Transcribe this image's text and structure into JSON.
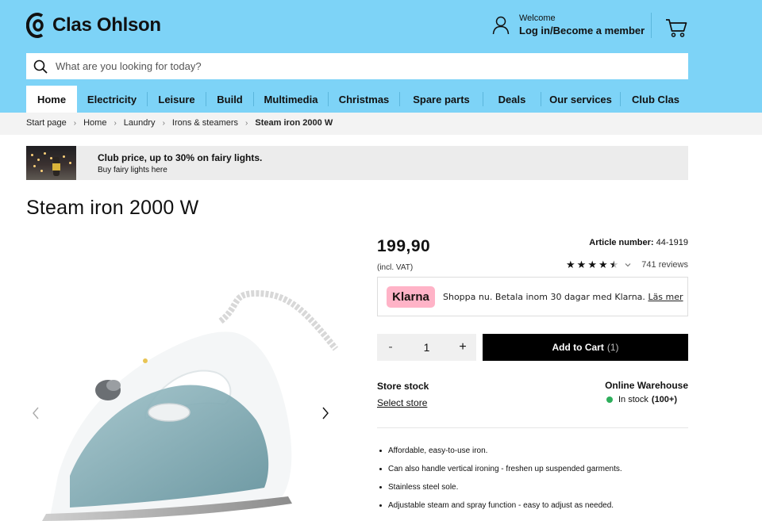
{
  "brand": {
    "name": "Clas Ohlson"
  },
  "account": {
    "welcome": "Welcome",
    "login": "Log in/Become a member"
  },
  "search": {
    "placeholder": "What are you looking for today?"
  },
  "nav": {
    "items": [
      {
        "label": "Home",
        "active": true
      },
      {
        "label": "Electricity"
      },
      {
        "label": "Leisure"
      },
      {
        "label": "Build"
      },
      {
        "label": "Multimedia"
      },
      {
        "label": "Christmas"
      },
      {
        "label": "Spare parts"
      },
      {
        "label": "Deals"
      },
      {
        "label": "Our services"
      },
      {
        "label": "Club Clas"
      }
    ]
  },
  "breadcrumb": [
    "Start page",
    "Home",
    "Laundry",
    "Irons & steamers",
    "Steam iron 2000 W"
  ],
  "promo": {
    "title": "Club price, up to 30% on fairy lights.",
    "subtitle": "Buy fairy lights here"
  },
  "product": {
    "title": "Steam iron 2000 W",
    "price": "199,90",
    "vat": "(incl. VAT)",
    "article_label": "Article number:",
    "article_number": "44-1919",
    "rating": 4.5,
    "reviews": "741 reviews",
    "quantity": "1",
    "add_to_cart": "Add to Cart",
    "cart_count": "(1)"
  },
  "klarna": {
    "badge": "Klarna",
    "text": "Shoppa nu. Betala inom 30 dagar med Klarna.",
    "link": "Läs mer"
  },
  "stock": {
    "store_label": "Store stock",
    "select_store": "Select store",
    "warehouse_label": "Online Warehouse",
    "status": "In stock",
    "count": "(100+)"
  },
  "features": [
    "Affordable, easy-to-use iron.",
    "Can also handle vertical ironing - freshen up suspended garments.",
    "Stainless steel sole.",
    "Adjustable steam and spray function - easy to adjust as needed."
  ],
  "colors": {
    "header": "#7dd3f7",
    "klarna": "#ffb3c7",
    "instock": "#2eae5b"
  },
  "icons": [
    "clas-ohlson-logo-icon",
    "user-icon",
    "cart-icon",
    "search-icon",
    "chevron-right-icon",
    "chevron-left-icon",
    "chevron-down-icon",
    "star-icon"
  ]
}
